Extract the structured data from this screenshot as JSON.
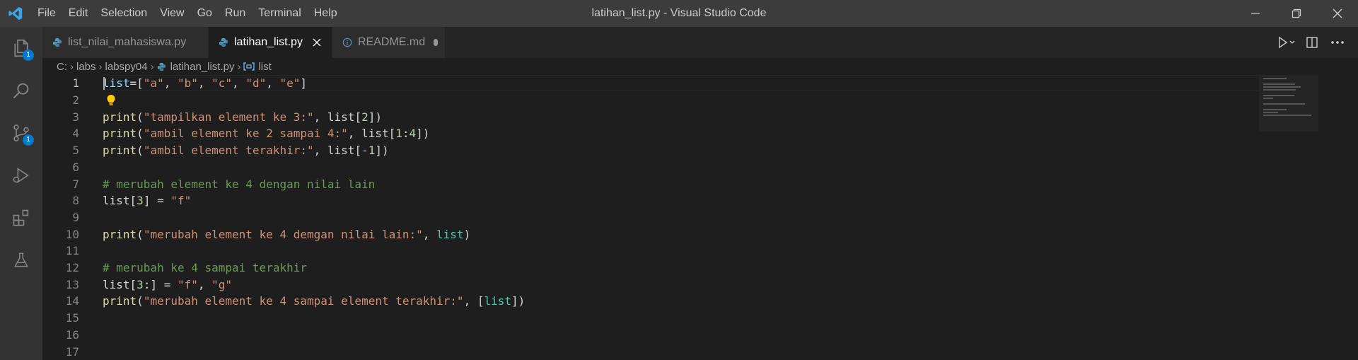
{
  "window": {
    "title": "latihan_list.py - Visual Studio Code",
    "menu": [
      "File",
      "Edit",
      "Selection",
      "View",
      "Go",
      "Run",
      "Terminal",
      "Help"
    ]
  },
  "activity_bar": {
    "explorer_badge": "1",
    "scm_badge": "1"
  },
  "tabs": [
    {
      "label": "list_nilai_mahasiswa.py",
      "icon": "python-icon",
      "active": false
    },
    {
      "label": "latihan_list.py",
      "icon": "python-icon",
      "active": true
    },
    {
      "label": "README.md",
      "icon": "info-icon",
      "active": false,
      "modified": true
    }
  ],
  "breadcrumb": [
    "C:",
    "labs",
    "labspy04",
    "latihan_list.py",
    "list"
  ],
  "editor": {
    "current_line": 1,
    "line_numbers": [
      "1",
      "2",
      "3",
      "4",
      "5",
      "6",
      "7",
      "8",
      "9",
      "10",
      "11",
      "12",
      "13",
      "14",
      "15",
      "16",
      "17"
    ],
    "lines": [
      [
        [
          "var",
          "list"
        ],
        [
          "txt",
          "=["
        ],
        [
          "str",
          "\"a\""
        ],
        [
          "txt",
          ", "
        ],
        [
          "str",
          "\"b\""
        ],
        [
          "txt",
          ", "
        ],
        [
          "str",
          "\"c\""
        ],
        [
          "txt",
          ", "
        ],
        [
          "str",
          "\"d\""
        ],
        [
          "txt",
          ", "
        ],
        [
          "str",
          "\"e\""
        ],
        [
          "txt",
          "]"
        ]
      ],
      [],
      [
        [
          "fn",
          "print"
        ],
        [
          "txt",
          "("
        ],
        [
          "str",
          "\"tampilkan element ke 3:\""
        ],
        [
          "txt",
          ", list["
        ],
        [
          "num",
          "2"
        ],
        [
          "txt",
          "])"
        ]
      ],
      [
        [
          "fn",
          "print"
        ],
        [
          "txt",
          "("
        ],
        [
          "str",
          "\"ambil element ke 2 sampai 4:\""
        ],
        [
          "txt",
          ", list["
        ],
        [
          "num",
          "1"
        ],
        [
          "txt",
          ":"
        ],
        [
          "num",
          "4"
        ],
        [
          "txt",
          "])"
        ]
      ],
      [
        [
          "fn",
          "print"
        ],
        [
          "txt",
          "("
        ],
        [
          "str",
          "\"ambil element terakhir:\""
        ],
        [
          "txt",
          ", list["
        ],
        [
          "num",
          "-1"
        ],
        [
          "txt",
          "])"
        ]
      ],
      [],
      [
        [
          "cmt",
          "# merubah element ke 4 dengan nilai lain"
        ]
      ],
      [
        [
          "txt",
          "list["
        ],
        [
          "num",
          "3"
        ],
        [
          "txt",
          "] = "
        ],
        [
          "str",
          "\"f\""
        ]
      ],
      [],
      [
        [
          "fn",
          "print"
        ],
        [
          "txt",
          "("
        ],
        [
          "str",
          "\"merubah element ke 4 demgan nilai lain:\""
        ],
        [
          "txt",
          ", "
        ],
        [
          "def",
          "list"
        ],
        [
          "txt",
          ")"
        ]
      ],
      [],
      [
        [
          "cmt",
          "# merubah ke 4 sampai terakhir"
        ]
      ],
      [
        [
          "txt",
          "list["
        ],
        [
          "num",
          "3"
        ],
        [
          "txt",
          ":] = "
        ],
        [
          "str",
          "\"f\""
        ],
        [
          "txt",
          ", "
        ],
        [
          "str",
          "\"g\""
        ]
      ],
      [
        [
          "fn",
          "print"
        ],
        [
          "txt",
          "("
        ],
        [
          "str",
          "\"merubah element ke 4 sampai element terakhir:\""
        ],
        [
          "txt",
          ", ["
        ],
        [
          "def",
          "list"
        ],
        [
          "txt",
          "])"
        ]
      ],
      [],
      [],
      []
    ]
  },
  "colors": {
    "accent": "#007acc",
    "string": "#ce9178",
    "function": "#dcdcaa",
    "comment": "#6a9955",
    "number": "#b5cea8",
    "variable": "#9cdcfe",
    "builtin": "#4ec9b0"
  }
}
